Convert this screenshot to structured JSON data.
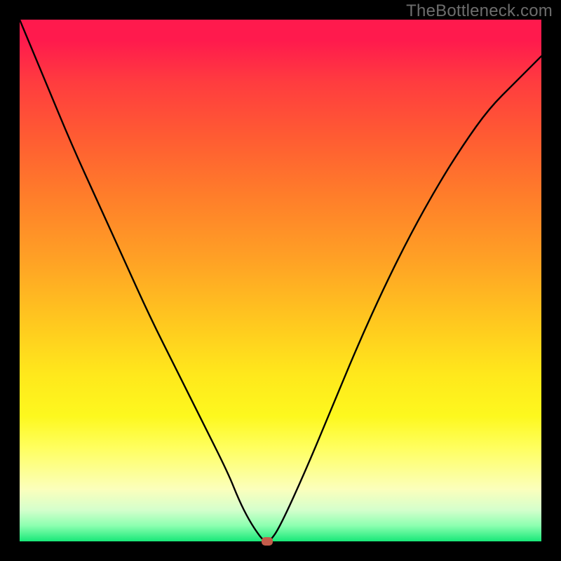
{
  "watermark": "TheBottleneck.com",
  "chart_data": {
    "type": "line",
    "title": "",
    "xlabel": "",
    "ylabel": "",
    "xlim": [
      0,
      100
    ],
    "ylim": [
      0,
      100
    ],
    "grid": false,
    "series": [
      {
        "name": "curve",
        "x": [
          0,
          5,
          10,
          15,
          20,
          25,
          30,
          35,
          40,
          42,
          44,
          46,
          47,
          48,
          50,
          55,
          60,
          65,
          70,
          75,
          80,
          85,
          90,
          95,
          100
        ],
        "values": [
          100,
          88,
          76,
          65,
          54,
          43,
          33,
          23,
          13,
          8,
          4,
          1,
          0,
          0,
          3,
          14,
          26,
          38,
          49,
          59,
          68,
          76,
          83,
          88,
          93
        ]
      }
    ],
    "marker": {
      "x": 47.5,
      "y": 0,
      "color": "#c35b4a"
    },
    "background_gradient": {
      "top_color": "#ff1a4d",
      "bottom_color": "#18e878"
    }
  }
}
